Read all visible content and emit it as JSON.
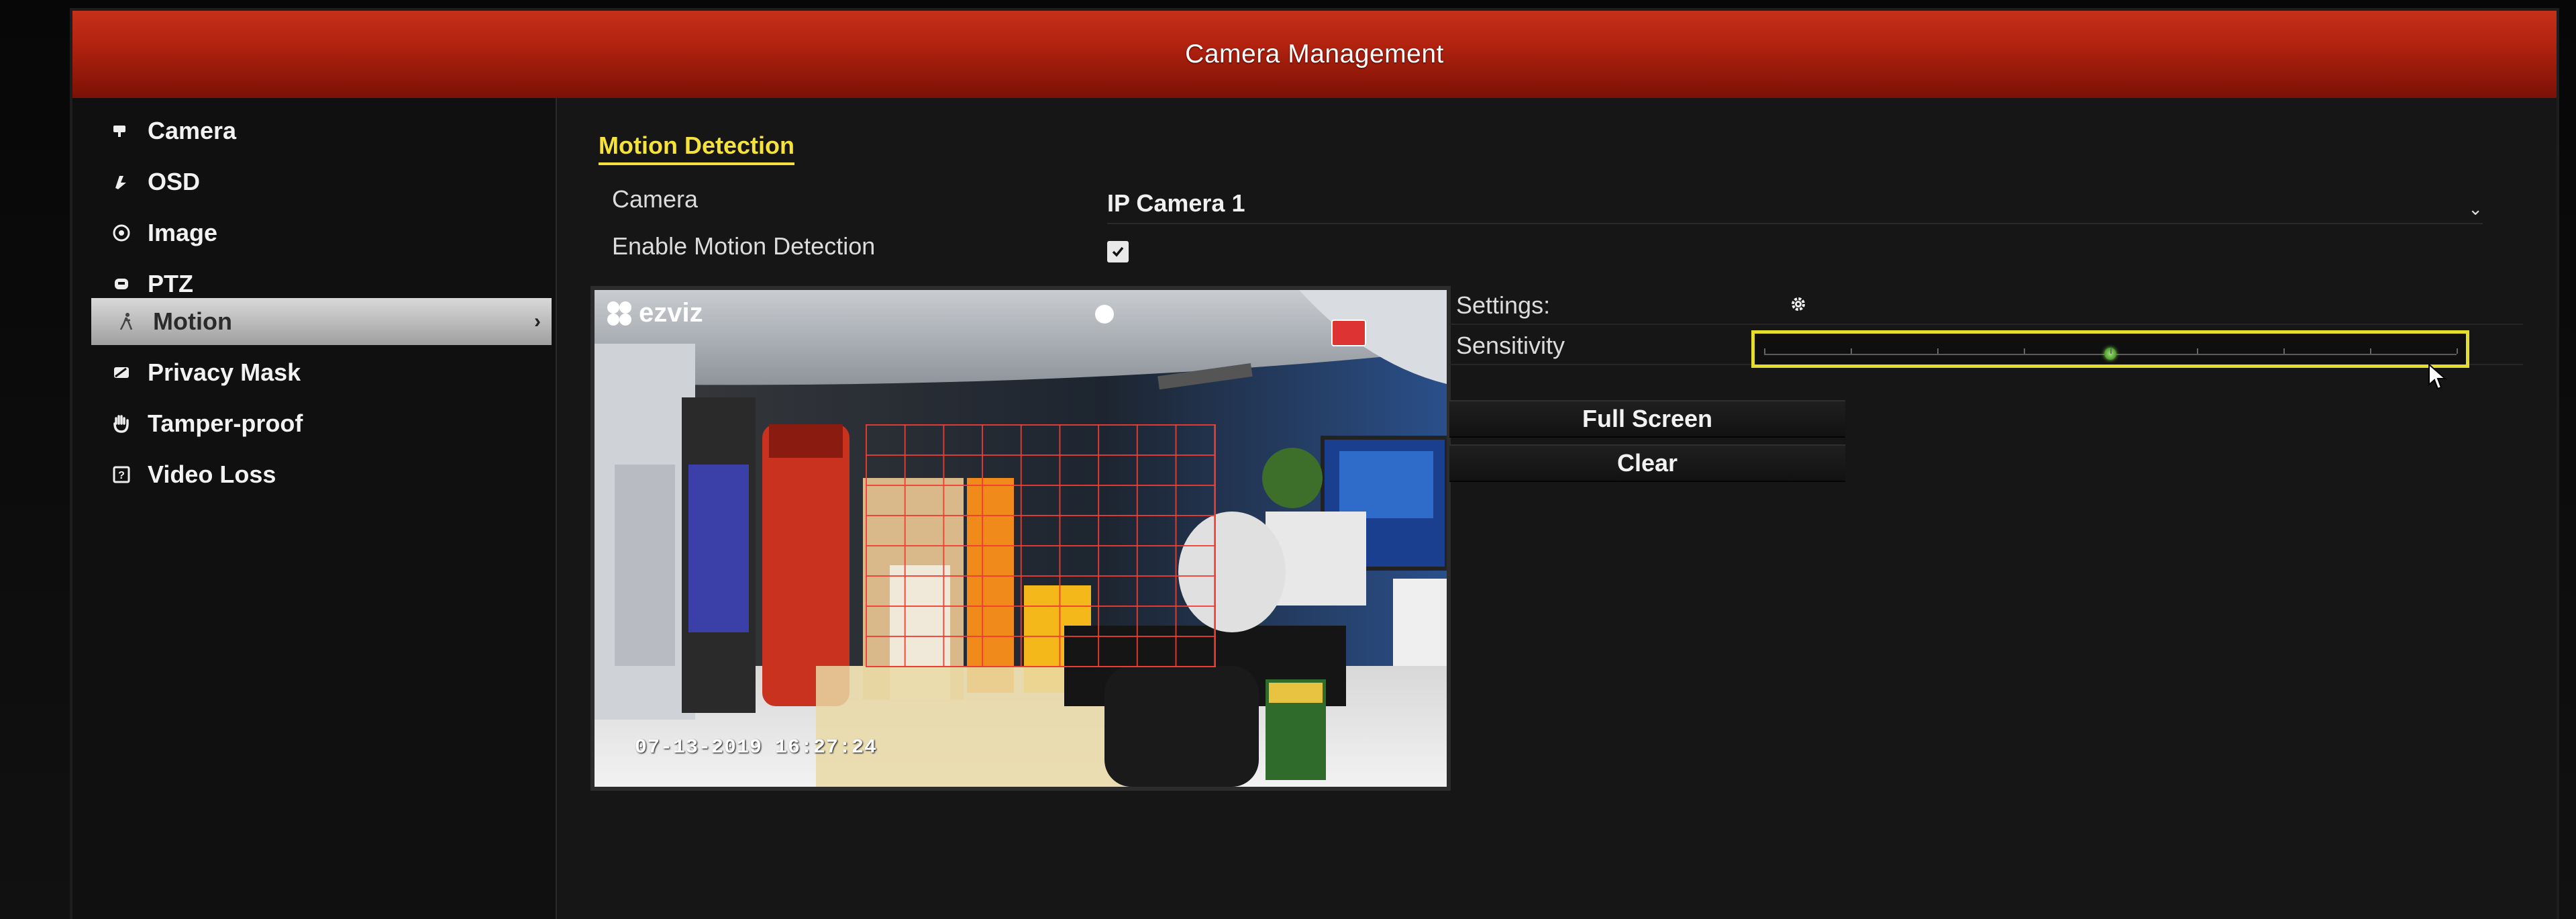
{
  "window": {
    "title": "Camera Management"
  },
  "sidebar": {
    "items": [
      {
        "label": "Camera",
        "icon": "camera-icon",
        "active": false
      },
      {
        "label": "OSD",
        "icon": "osd-icon",
        "active": false
      },
      {
        "label": "Image",
        "icon": "image-icon",
        "active": false
      },
      {
        "label": "PTZ",
        "icon": "ptz-icon",
        "active": false
      },
      {
        "label": "Motion",
        "icon": "motion-icon",
        "active": true
      },
      {
        "label": "Privacy Mask",
        "icon": "privacy-mask-icon",
        "active": false
      },
      {
        "label": "Tamper-proof",
        "icon": "tamper-proof-icon",
        "active": false
      },
      {
        "label": "Video Loss",
        "icon": "video-loss-icon",
        "active": false
      }
    ]
  },
  "main": {
    "section_title": "Motion Detection",
    "camera_label": "Camera",
    "camera_value": "IP Camera 1",
    "enable_label": "Enable Motion Detection",
    "enable_checked": true,
    "preview": {
      "brand": "ezviz",
      "timestamp": "07-13-2019 16:27:24"
    },
    "settings_label": "Settings:",
    "sensitivity_label": "Sensitivity",
    "sensitivity_level": 0.5,
    "full_screen_label": "Full Screen",
    "clear_label": "Clear"
  },
  "colors": {
    "title_bar": "#b1220f",
    "accent_yellow": "#f5e23a",
    "grid_red": "#f03c32",
    "slider_thumb": "#7fd04a"
  }
}
